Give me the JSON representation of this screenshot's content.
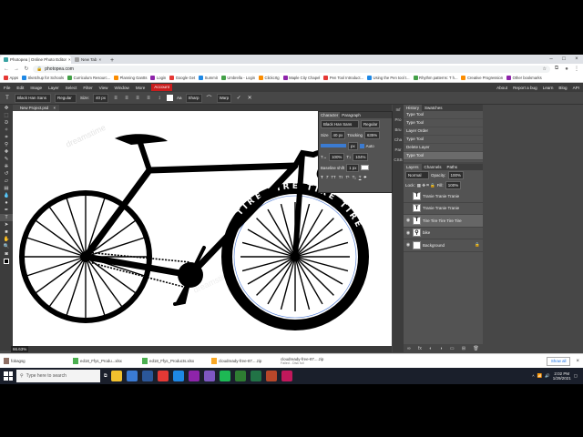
{
  "browser": {
    "tabs": [
      {
        "label": "Photopea | Online Photo Editor",
        "active": true,
        "color": "#3aa3a3"
      },
      {
        "label": "New Tab",
        "active": false,
        "color": "#9e9e9e"
      }
    ],
    "url": "photopea.com",
    "bookmarks": [
      "Apps",
      "Sketchup for Schools",
      "Curriculum Resourc...",
      "Planning Gantts",
      "Login",
      "Google Get",
      "Summit",
      "Umbrella - Login",
      "Clickcrtg",
      "Maple City Chapel",
      "Pen Tool Introduct...",
      "Using the Pen tool t...",
      "Rhythm patterns: T h...",
      "Creative Progression",
      "Other bookmarks"
    ]
  },
  "photopea": {
    "menu": [
      "File",
      "Edit",
      "Image",
      "Layer",
      "Select",
      "Filter",
      "View",
      "Window",
      "More"
    ],
    "account_label": "Account",
    "menu_right": [
      "About",
      "Report a bug",
      "Learn",
      "Blog",
      "API"
    ],
    "options": {
      "font": "Black Han Sans",
      "style": "Regular",
      "size": "40 px",
      "antialias_label": "Aa",
      "antialias": "Sharp",
      "warp_label": "Warp"
    },
    "doc_tab": "New Project.psd",
    "zoom": "66.63%",
    "character": {
      "tabs": [
        "Character",
        "Paragraph"
      ],
      "font": "Black Han Sans",
      "style": "Regular",
      "size": "40 px",
      "tracking_label": "Tracking",
      "tracking": "635%",
      "leading": "px",
      "auto_label": "Auto",
      "scale_h": "100%",
      "scale_v": "104%",
      "baseline_label": "Baseline shift",
      "baseline": "1 px",
      "style_buttons": [
        "T",
        "T",
        "TT",
        "Tт",
        "T¹",
        "T₁",
        "T",
        "T"
      ]
    },
    "history": {
      "tabs": [
        "History",
        "Swatches"
      ],
      "items": [
        "Type Tool",
        "Type Tool",
        "Layer Order",
        "Type Tool",
        "Delete Layer",
        "Type Tool"
      ],
      "selected_index": 5
    },
    "layers": {
      "tabs": [
        "Layers",
        "Channels",
        "Paths"
      ],
      "blend": "Normal",
      "opacity_label": "Opacity:",
      "opacity": "100%",
      "lock_label": "Lock:",
      "fill_label": "Fill:",
      "fill": "100%",
      "items": [
        {
          "name": "Tranie Tranie Tranie",
          "type": "text",
          "visible": false
        },
        {
          "name": "Tranie Tranie Tranie",
          "type": "text",
          "visible": false
        },
        {
          "name": "Tire Tire Tire Tire Tire",
          "type": "text",
          "visible": true
        },
        {
          "name": "bike",
          "type": "image",
          "visible": true
        },
        {
          "name": "Background",
          "type": "fill",
          "visible": true
        }
      ]
    },
    "right_strip": [
      "Inf",
      "Pro",
      "Bru",
      "Cha",
      "Par",
      "CSS"
    ]
  },
  "canvas": {
    "tire_text": "TIRE TIRE TIRE TIRE",
    "watermark": "dreamstime"
  },
  "downloads": {
    "items": [
      {
        "name": "fobagsg",
        "sub": ""
      },
      {
        "name": "ed18_Ffys_Produ...xlsx",
        "sub": ""
      },
      {
        "name": "ed18_Ffys_Products.xlsx",
        "sub": ""
      },
      {
        "name": "cloudready-free-87....zip",
        "sub": ""
      },
      {
        "name": "cloudready-free-87....zip",
        "sub": "Failed - Disk full"
      }
    ],
    "show_all": "Show all"
  },
  "taskbar": {
    "search_placeholder": "Type here to search",
    "time": "2:02 PM",
    "date": "1/29/2021",
    "app_colors": [
      "#f2c12e",
      "#3a7bd5",
      "#2b579a",
      "#e53935",
      "#1e88e5",
      "#8e24aa",
      "#7e57c2",
      "#1db954",
      "#2e7d32",
      "#217346",
      "#b7472a",
      "#c2185b"
    ]
  }
}
